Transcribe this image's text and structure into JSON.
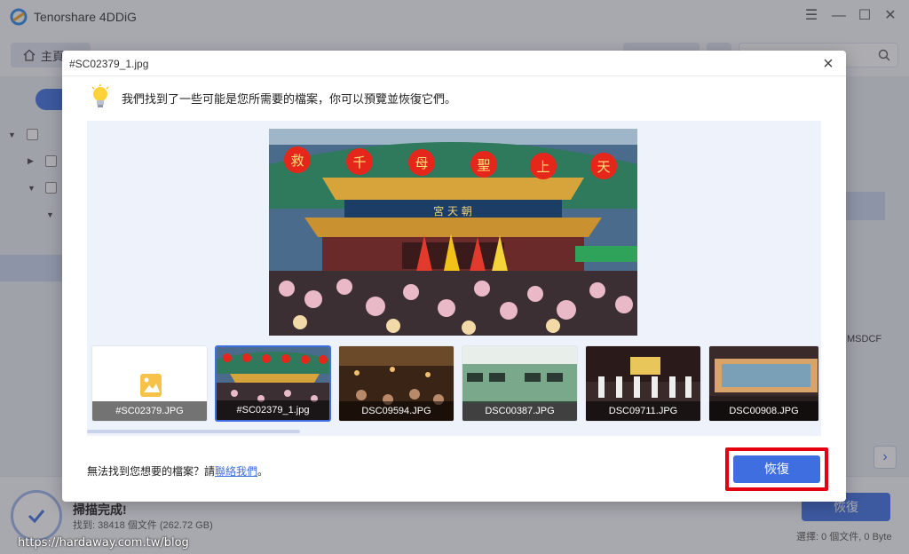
{
  "app": {
    "title": "Tenorshare 4DDiG",
    "home_tab": "主頁"
  },
  "background": {
    "tree_label_right": "MSDCF",
    "scan_title": "掃描完成!",
    "scan_detail": "找到: 38418 個文件 (262.72 GB)",
    "recover_label": "恢復",
    "selection_status": "選擇: 0 個文件, 0 Byte",
    "watermark": "https://hardaway.com.tw/blog"
  },
  "modal": {
    "title": "#SC02379_1.jpg",
    "tip": "我們找到了一些可能是您所需要的檔案，你可以預覽並恢復它們。",
    "help_prefix": "無法找到您想要的檔案？請",
    "help_link": "聯絡我們",
    "help_suffix": "。",
    "recover_button": "恢復",
    "main_image": {
      "signs": [
        "救",
        "千",
        "母",
        "聖",
        "上",
        "天"
      ],
      "plaque": "宮 天 朝"
    },
    "thumbnails": [
      {
        "label": "#SC02379.JPG",
        "kind": "placeholder"
      },
      {
        "label": "#SC02379_1.jpg",
        "kind": "temple",
        "active": true
      },
      {
        "label": "DSC09594.JPG",
        "kind": "market"
      },
      {
        "label": "DSC00387.JPG",
        "kind": "train"
      },
      {
        "label": "DSC09711.JPG",
        "kind": "stage"
      },
      {
        "label": "DSC00908.JPG",
        "kind": "banner"
      }
    ]
  },
  "colors": {
    "accent": "#3e6ee0",
    "highlight_frame": "#e5000f"
  }
}
